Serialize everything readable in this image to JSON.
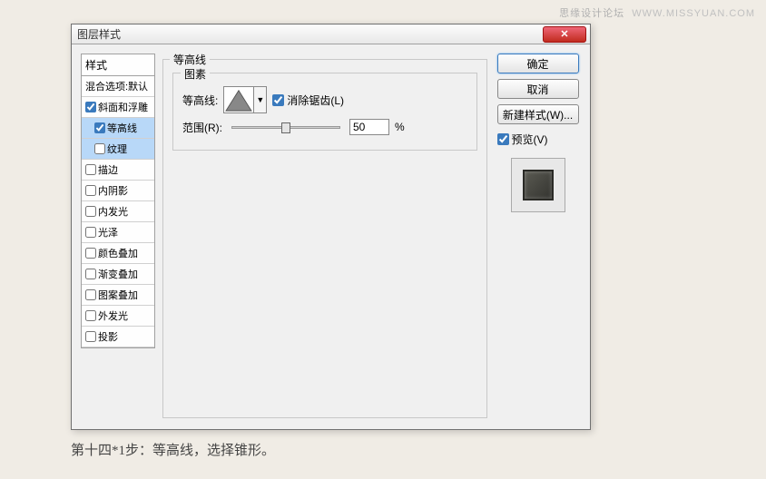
{
  "watermark": {
    "cn": "思缘设计论坛",
    "en": "WWW.MISSYUAN.COM"
  },
  "dialog": {
    "title": "图层样式",
    "closeGlyph": "✕",
    "stylesHeader": "样式",
    "styles": [
      {
        "label": "混合选项:默认",
        "checked": null,
        "selected": false,
        "sub": false
      },
      {
        "label": "斜面和浮雕",
        "checked": true,
        "selected": false,
        "sub": false
      },
      {
        "label": "等高线",
        "checked": true,
        "selected": true,
        "sub": true
      },
      {
        "label": "纹理",
        "checked": false,
        "selected": true,
        "sub": true
      },
      {
        "label": "描边",
        "checked": false,
        "selected": false,
        "sub": false
      },
      {
        "label": "内阴影",
        "checked": false,
        "selected": false,
        "sub": false
      },
      {
        "label": "内发光",
        "checked": false,
        "selected": false,
        "sub": false
      },
      {
        "label": "光泽",
        "checked": false,
        "selected": false,
        "sub": false
      },
      {
        "label": "颜色叠加",
        "checked": false,
        "selected": false,
        "sub": false
      },
      {
        "label": "渐变叠加",
        "checked": false,
        "selected": false,
        "sub": false
      },
      {
        "label": "图案叠加",
        "checked": false,
        "selected": false,
        "sub": false
      },
      {
        "label": "外发光",
        "checked": false,
        "selected": false,
        "sub": false
      },
      {
        "label": "投影",
        "checked": false,
        "selected": false,
        "sub": false
      }
    ],
    "section": {
      "outerTitle": "等高线",
      "groupTitle": "图素",
      "contourLabel": "等高线:",
      "antiAlias": "消除锯齿(L)",
      "rangeLabel": "范围(R):",
      "rangeValue": "50",
      "rangeUnit": "%"
    },
    "buttons": {
      "ok": "确定",
      "cancel": "取消",
      "newStyle": "新建样式(W)...",
      "preview": "预览(V)"
    }
  },
  "caption": "第十四*1步：等高线，选择锥形。"
}
